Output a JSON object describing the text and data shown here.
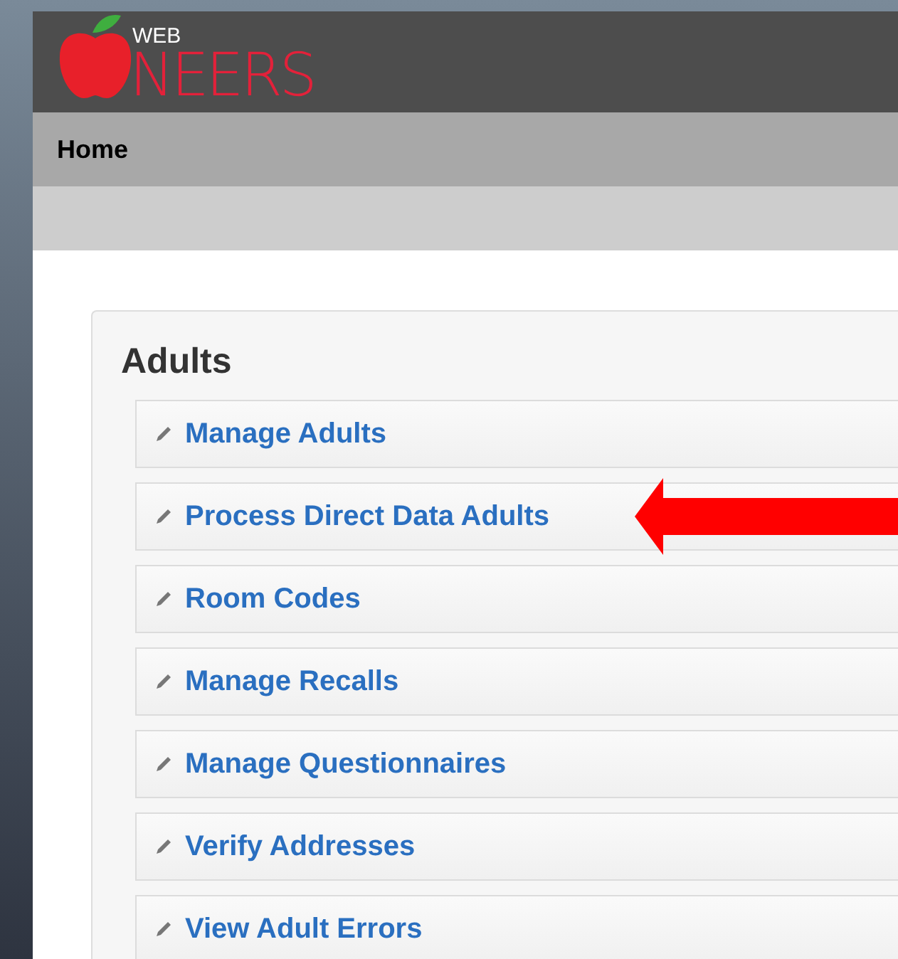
{
  "logo": {
    "small_text": "WEB",
    "large_text": "NEERS"
  },
  "nav": {
    "items": [
      {
        "label": "Home"
      }
    ]
  },
  "panel": {
    "title": "Adults",
    "items": [
      {
        "label": "Manage Adults",
        "pointed": false
      },
      {
        "label": "Process Direct Data Adults",
        "pointed": true
      },
      {
        "label": "Room Codes",
        "pointed": false
      },
      {
        "label": "Manage Recalls",
        "pointed": false
      },
      {
        "label": "Manage Questionnaires",
        "pointed": false
      },
      {
        "label": "Verify Addresses",
        "pointed": false
      },
      {
        "label": "View Adult Errors",
        "pointed": false
      }
    ]
  }
}
